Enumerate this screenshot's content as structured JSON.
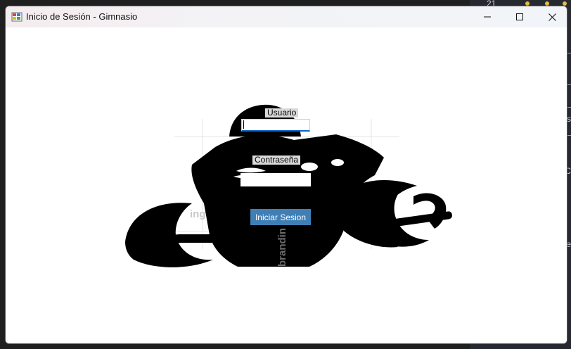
{
  "window": {
    "title": "Inicio de Sesión - Gimnasio",
    "controls": [
      "minimize",
      "maximize",
      "close"
    ]
  },
  "form": {
    "usuario_label": "Usuario",
    "usuario_value": "",
    "contrasena_label": "Contraseña",
    "contrasena_value": "",
    "login_button": "Iniciar Sesion"
  },
  "background": {
    "number": "21",
    "letters": [
      "s",
      "C",
      "e"
    ]
  },
  "colors": {
    "button": "#3f7fb5",
    "focus_underline": "#0b63c8",
    "label_bg": "#d9d9d9"
  }
}
